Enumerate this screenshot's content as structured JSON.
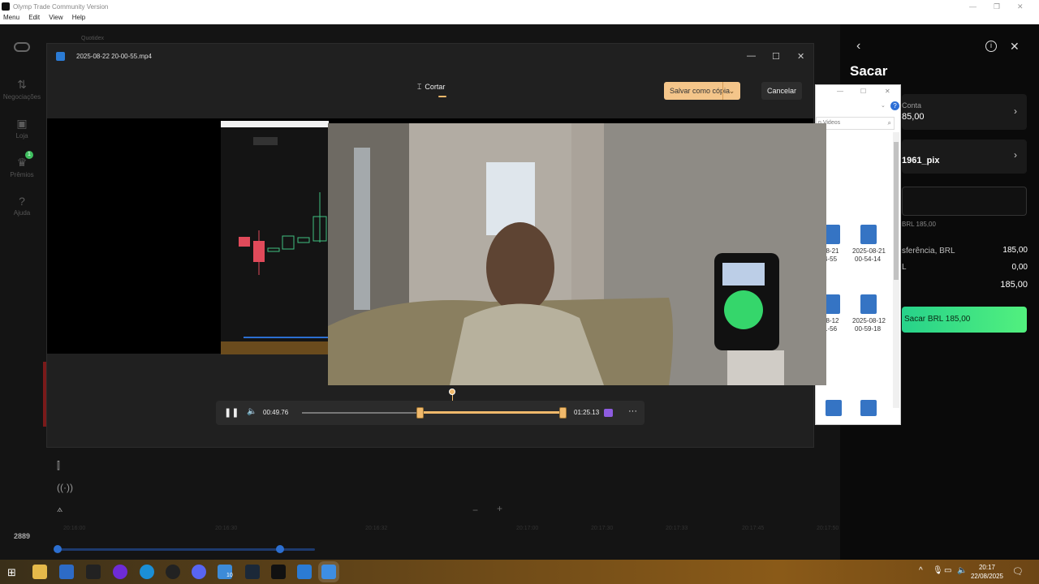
{
  "app": {
    "title": "Olymp Trade Community Version",
    "menu": [
      "Menu",
      "Edit",
      "View",
      "Help"
    ]
  },
  "sidebar": {
    "items": [
      {
        "label": "Negociações",
        "icon": "trade-arrows-icon"
      },
      {
        "label": "Loja",
        "icon": "bag-icon"
      },
      {
        "label": "Prêmios",
        "icon": "trophy-icon"
      },
      {
        "label": "Ajuda",
        "icon": "help-icon"
      }
    ],
    "badge": "1",
    "tab_label": "Quotidex"
  },
  "player": {
    "filename": "2025-08-22 20-00-55.mp4",
    "tab_cut": "Cortar",
    "save_copy": "Salvar como cópia",
    "cancel": "Cancelar",
    "current_time": "00:49.76",
    "end_time": "01:25.13",
    "trim_start_fraction": 0.45,
    "trim_end_fraction": 1.0
  },
  "explorer": {
    "search_placeholder": "n Videos",
    "files": [
      {
        "line1": "08-21",
        "line2": "4-55"
      },
      {
        "line1": "2025-08-21",
        "line2": "00-54-14"
      },
      {
        "line1": "08-12",
        "line2": "1-56"
      },
      {
        "line1": "2025-08-12",
        "line2": "00-59-18"
      }
    ]
  },
  "withdraw": {
    "title": "Sacar",
    "account_label": "Conta",
    "account_value": "85,00",
    "method_value": "1961_pix",
    "min_label": "BRL 185,00",
    "transfer_label": "sferência, BRL",
    "transfer_value": "185,00",
    "fee_label": "L",
    "fee_value": "0,00",
    "total_value": "185,00",
    "submit": "Sacar BRL 185,00"
  },
  "chart": {
    "balance": "2889",
    "tick_labels": [
      "20:16:00",
      "20:16:30",
      "20:16:32",
      "20:17:00",
      "20:17:30",
      "20:17:33",
      "20:17:45",
      "20:17:50"
    ]
  },
  "taskbar": {
    "time": "20:17",
    "date": "22/08/2025",
    "badge": "10"
  },
  "colors": {
    "accent": "#f0b96b",
    "submit_green": "#39e48a",
    "taskbar": "#6d4a18"
  }
}
